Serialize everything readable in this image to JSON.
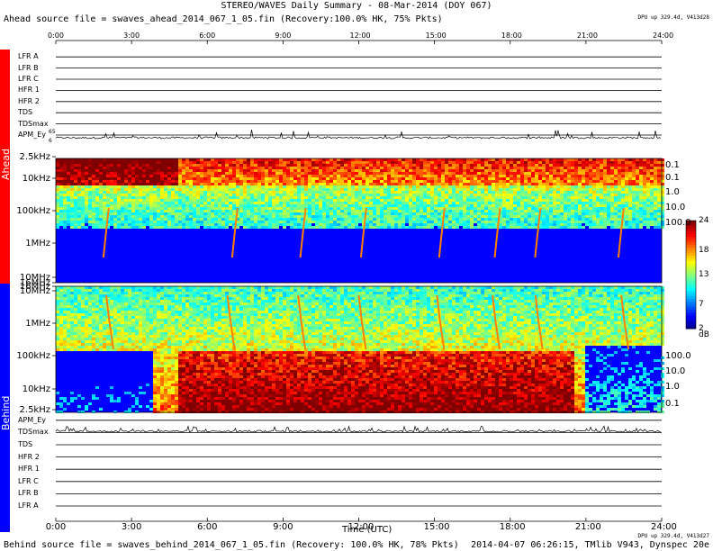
{
  "title": "STEREO/WAVES Daily Summary - 08-Mar-2014 (DOY 067)",
  "ahead_file": "Ahead source file = swaves_ahead_2014_067_1_05.fin (Recovery:100.0% HK, 75% Pkts)",
  "behind_file": "Behind source file = swaves_behind_2014_067_1_05.fin (Recovery: 100.0% HK, 78% Pkts)",
  "footer": "2014-04-07 06:26:15, TMlib V943, Dynspec 20e",
  "dpu_ahead": "DPU up 329.4d, V413d28",
  "dpu_behind": "DPU up 329.4d, V413d27",
  "side_labels": {
    "ahead": "Ahead",
    "behind": "Behind"
  },
  "colors": {
    "ahead": "#ff0000",
    "behind": "#0000ff",
    "spectrogram_bg": "#0000ff"
  },
  "chart_data": {
    "type": "heatmap",
    "xlabel": "Time (UTC)",
    "x_ticks": [
      "0:00",
      "3:00",
      "6:00",
      "9:00",
      "12:00",
      "15:00",
      "18:00",
      "21:00",
      "24:00"
    ],
    "x_range_hours": [
      0,
      24
    ],
    "ahead_channels": [
      "LFR A",
      "LFR B",
      "LFR C",
      "HFR 1",
      "HFR 2",
      "TDS",
      "TDSmax",
      "APM_Ey"
    ],
    "behind_channels": [
      "APM_Ey",
      "TDSmax",
      "TDS",
      "HFR 2",
      "HFR 1",
      "LFR C",
      "LFR B",
      "LFR A"
    ],
    "ahead_freq_labels": [
      "2.5kHz",
      "10kHz",
      "100kHz",
      "1MHz",
      "10MHz",
      "16MHz"
    ],
    "behind_freq_labels": [
      "16MHz",
      "10MHz",
      "1MHz",
      "100kHz",
      "10kHz",
      "2.5kHz"
    ],
    "ahead_wavelength_labels": [
      "0.1",
      "1.0",
      "10.0",
      "100.0"
    ],
    "behind_wavelength_labels": [
      "100.0",
      "10.0",
      "1.0",
      "0.1"
    ],
    "colorbar": {
      "ticks": [
        "24",
        "18",
        "13",
        "7",
        "2"
      ],
      "unit": "dB",
      "range": [
        2,
        24
      ]
    },
    "tdsmax_scale": [
      "65",
      "6"
    ]
  }
}
